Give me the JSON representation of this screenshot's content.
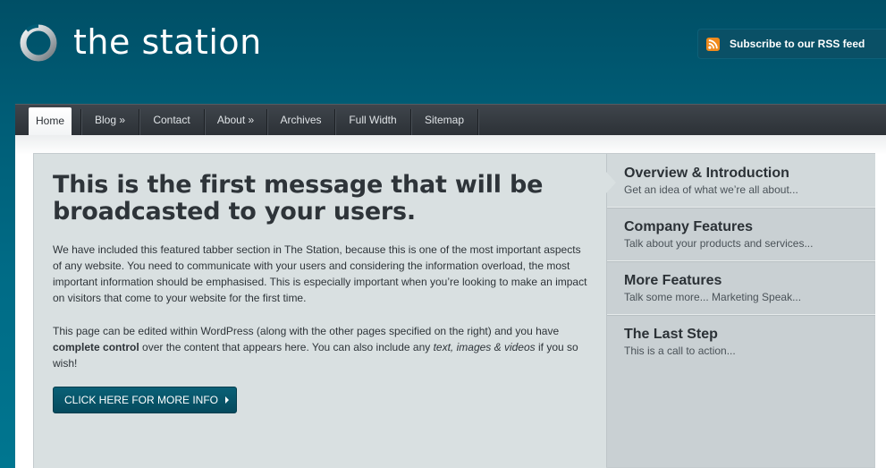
{
  "header": {
    "site_title": "the station",
    "logo_icon": "ring-logo-icon",
    "rss": {
      "label": "Subscribe to our RSS feed",
      "icon": "rss-icon",
      "icon_color": "#f08a1c"
    }
  },
  "nav": {
    "items": [
      {
        "label": "Home",
        "active": true
      },
      {
        "label": "Blog »"
      },
      {
        "label": "Contact"
      },
      {
        "label": "About »"
      },
      {
        "label": "Archives"
      },
      {
        "label": "Full Width"
      },
      {
        "label": "Sitemap"
      }
    ]
  },
  "feature": {
    "headline": "This is the first message that will be broadcasted to your users.",
    "paragraph_1": "We have included this featured tabber section in The Station, because this is one of the most important aspects of any website. You need to communicate with your users and considering the information overload, the most important information should be emphasised. This is especially important when you’re looking to make an impact on visitors that come to your website for the first time.",
    "paragraph_2": {
      "part_1": "This page can be edited within WordPress (along with the other pages specified on the right) and you have ",
      "bold": "complete control",
      "part_2": " over the content that appears here. You can also include any ",
      "italic": "text, images & videos",
      "part_3": " if you so wish!"
    },
    "cta_label": "CLICK HERE FOR MORE INFO"
  },
  "tabs": [
    {
      "title": "Overview & Introduction",
      "subtitle": "Get an idea of what we’re all about...",
      "active": true
    },
    {
      "title": "Company Features",
      "subtitle": "Talk about your products and services..."
    },
    {
      "title": "More Features",
      "subtitle": "Talk some more... Marketing Speak..."
    },
    {
      "title": "The Last Step",
      "subtitle": "This is a call to action..."
    }
  ],
  "colors": {
    "header_bg": "#005b74",
    "nav_bg": "#33383d",
    "cta_bg": "#075568",
    "feature_bg": "#d9e0e1"
  }
}
